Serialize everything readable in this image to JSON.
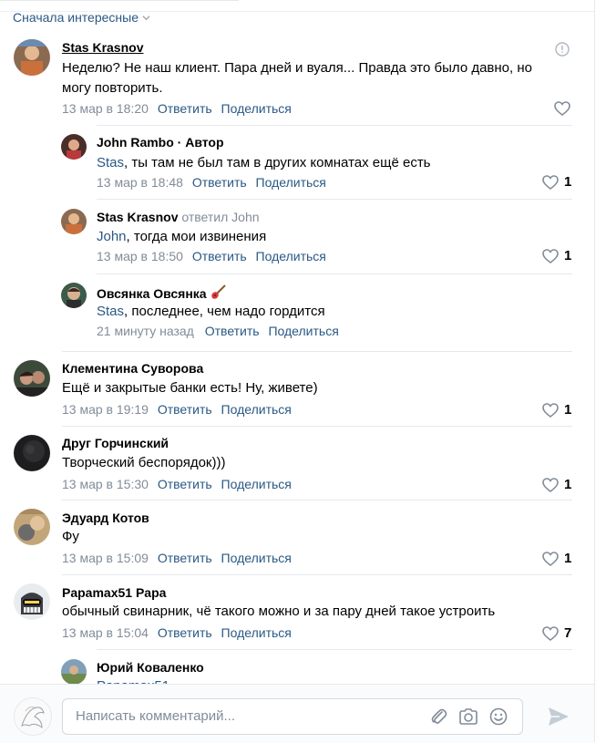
{
  "sort": {
    "label": "Сначала интересные"
  },
  "actions": {
    "reply": "Ответить",
    "share": "Поделиться"
  },
  "comments": [
    {
      "author": "Stas Krasnov",
      "text_lines": [
        "Неделю? Не наш клиент. Пара дней и вуаля... Правда это было давно, но",
        "могу повторить."
      ],
      "time": "13 мар в 18:20",
      "likes": ""
    },
    {
      "author": "John Rambo",
      "author_suffix": " · Автор",
      "mention": "Stas",
      "text": ", ты там не был там в других комнатах ещё есть",
      "time": "13 мар в 18:48",
      "likes": "1"
    },
    {
      "author": "Stas Krasnov",
      "replied": " ответил John",
      "mention": "John",
      "text": ", тогда мои извинения",
      "time": "13 мар в 18:50",
      "likes": "1"
    },
    {
      "author": "Овсянка Овсянка",
      "mention": "Stas",
      "text": ", последнее, чем надо гордится",
      "time": "21 минуту назад",
      "likes": ""
    },
    {
      "author": "Клементина Суворова",
      "text": "Ещё и закрытые банки есть! Ну, живете)",
      "time": "13 мар в 19:19",
      "likes": "1"
    },
    {
      "author": "Друг Горчинский",
      "text": "Творческий беспорядок)))",
      "time": "13 мар в 15:30",
      "likes": "1"
    },
    {
      "author": "Эдуард Котов",
      "text": "Фу",
      "time": "13 мар в 15:09",
      "likes": "1"
    },
    {
      "author": "Papamax51 Papa",
      "text": "обычный свинарник, чё такого можно и за пару дней такое устроить",
      "time": "13 мар в 15:04",
      "likes": "7"
    },
    {
      "author": "Юрий Коваленко",
      "text_partial": "Papamax51"
    }
  ],
  "composer": {
    "placeholder": "Написать комментарий..."
  },
  "colors": {
    "link": "#2a5885",
    "muted": "#818c99",
    "border": "#e7e8ec"
  }
}
